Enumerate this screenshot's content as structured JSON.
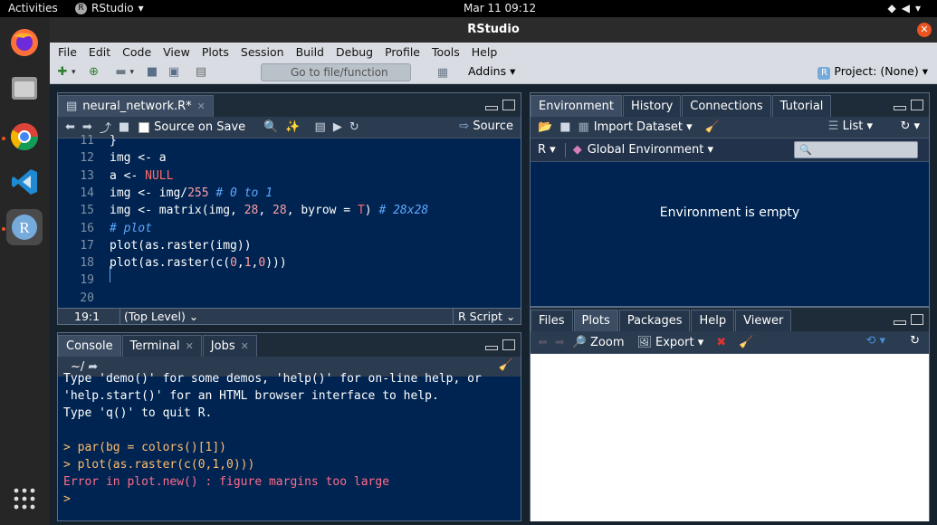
{
  "topbar": {
    "activities": "Activities",
    "app_name": "RStudio",
    "clock": "Mar 11  09:12"
  },
  "window": {
    "title": "RStudio"
  },
  "menu": [
    "File",
    "Edit",
    "Code",
    "View",
    "Plots",
    "Session",
    "Build",
    "Debug",
    "Profile",
    "Tools",
    "Help"
  ],
  "toolbar": {
    "goto_placeholder": "Go to file/function",
    "addins": "Addins",
    "project": "Project: (None)"
  },
  "editor": {
    "tab_label": "neural_network.R*",
    "source_on_save": "Source on Save",
    "source_btn": "Source",
    "lines": [
      {
        "n": "11",
        "html": "}"
      },
      {
        "n": "12",
        "html": "img <- a"
      },
      {
        "n": "13",
        "html": "a <- <span class=\"kw\">NULL</span>"
      },
      {
        "n": "14",
        "html": "img <- img/<span class=\"num\">255</span> <span class=\"cm\"># 0 to 1</span>"
      },
      {
        "n": "15",
        "html": "img <- matrix(img, <span class=\"num\">28</span>, <span class=\"num\">28</span>, byrow = <span class=\"kw\">T</span>) <span class=\"cm\"># 28x28</span>"
      },
      {
        "n": "16",
        "html": "<span class=\"cm\"># plot</span>"
      },
      {
        "n": "17",
        "html": "plot(as.raster(img))"
      },
      {
        "n": "18",
        "html": "plot(as.raster(c(<span class=\"num\">0</span>,<span class=\"num\">1</span>,<span class=\"num\">0</span>)))"
      },
      {
        "n": "19",
        "html": ""
      },
      {
        "n": "20",
        "html": ""
      }
    ],
    "status_pos": "19:1",
    "status_scope": "(Top Level) ⌄",
    "status_type": "R Script ⌄"
  },
  "console": {
    "tabs": [
      "Console",
      "Terminal",
      "Jobs"
    ],
    "path": "~/",
    "lines": [
      {
        "cls": "",
        "text": "Type 'demo()' for some demos, 'help()' for on-line help, or"
      },
      {
        "cls": "",
        "text": "'help.start()' for an HTML browser interface to help."
      },
      {
        "cls": "",
        "text": "Type 'q()' to quit R."
      },
      {
        "cls": "",
        "text": ""
      },
      {
        "cls": "prompt",
        "text": "> par(bg = colors()[1])"
      },
      {
        "cls": "prompt",
        "text": "> plot(as.raster(c(0,1,0)))"
      },
      {
        "cls": "err",
        "text": "Error in plot.new() : figure margins too large"
      },
      {
        "cls": "prompt",
        "text": "> "
      }
    ]
  },
  "env": {
    "tabs": [
      "Environment",
      "History",
      "Connections",
      "Tutorial"
    ],
    "import_dataset": "Import Dataset",
    "list": "List",
    "lang": "R",
    "global_env": "Global Environment",
    "empty_msg": "Environment is empty"
  },
  "files": {
    "tabs": [
      "Files",
      "Plots",
      "Packages",
      "Help",
      "Viewer"
    ],
    "zoom": "Zoom",
    "export": "Export"
  }
}
